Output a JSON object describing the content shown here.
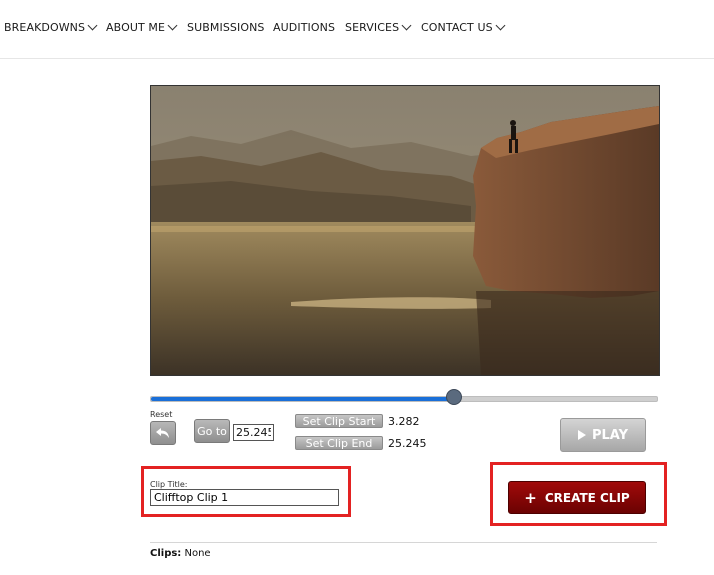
{
  "nav": {
    "items": [
      {
        "label": "BREAKDOWNS",
        "dropdown": true
      },
      {
        "label": "ABOUT ME",
        "dropdown": true
      },
      {
        "label": "SUBMISSIONS",
        "dropdown": false
      },
      {
        "label": "AUDITIONS",
        "dropdown": false
      },
      {
        "label": "SERVICES",
        "dropdown": true
      },
      {
        "label": "CONTACT US",
        "dropdown": true
      }
    ]
  },
  "player": {
    "progress_fraction": 0.6,
    "reset_label": "Reset",
    "goto_label": "Go to",
    "goto_value": "25.245",
    "set_clip_start_label": "Set Clip Start",
    "clip_start_value": "3.282",
    "set_clip_end_label": "Set Clip End",
    "clip_end_value": "25.245",
    "play_label": "PLAY"
  },
  "clip": {
    "title_label": "Clip Title:",
    "title_value": "Clifftop Clip 1",
    "create_label": "CREATE CLIP"
  },
  "clips": {
    "label": "Clips:",
    "value": "None"
  },
  "colors": {
    "highlight": "#e32222",
    "accent": "#1a6fd8",
    "create_button": "#8b0505"
  }
}
